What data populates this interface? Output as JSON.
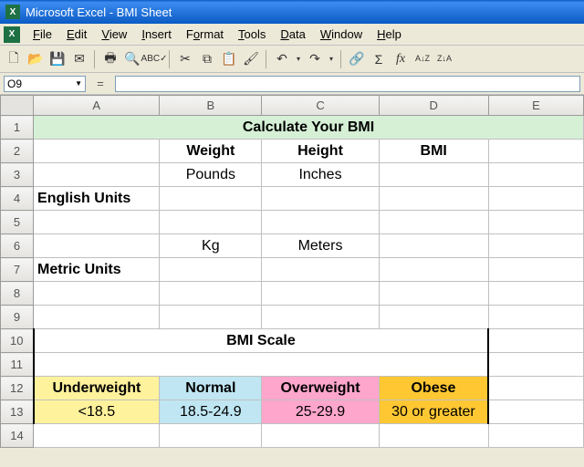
{
  "title_bar": {
    "text": "Microsoft Excel - BMI Sheet"
  },
  "menu": {
    "file": "File",
    "edit": "Edit",
    "view": "View",
    "insert": "Insert",
    "format": "Format",
    "tools": "Tools",
    "data": "Data",
    "window": "Window",
    "help": "Help"
  },
  "toolbar_icons": {
    "new": "🗋",
    "open": "📂",
    "save": "💾",
    "email": "✉",
    "print": "🖶",
    "preview": "🔍",
    "spell": "✓",
    "cut": "✂",
    "copy": "⧉",
    "paste": "📋",
    "format_painter": "🖌",
    "undo": "↶",
    "redo": "↷",
    "hyperlink": "🔗",
    "autosum": "Σ",
    "fx": "fx",
    "sort_asc": "A↓Z",
    "sort_desc": "Z↓A"
  },
  "namebox": {
    "value": "O9",
    "formula": "="
  },
  "columns": [
    "A",
    "B",
    "C",
    "D",
    "E"
  ],
  "rows": [
    "1",
    "2",
    "3",
    "4",
    "5",
    "6",
    "7",
    "8",
    "9",
    "10",
    "11",
    "12",
    "13",
    "14"
  ],
  "cells": {
    "r1_title": "Calculate Your BMI",
    "b2": "Weight",
    "c2": "Height",
    "d2": "BMI",
    "b3": "Pounds",
    "c3": "Inches",
    "a4": "English Units",
    "b6": "Kg",
    "c6": "Meters",
    "a7": "Metric Units",
    "r10_title": "BMI Scale",
    "a12": "Underweight",
    "b12": "Normal",
    "c12": "Overweight",
    "d12": "Obese",
    "a13": "<18.5",
    "b13": "18.5-24.9",
    "c13": "25-29.9",
    "d13": "30 or greater"
  }
}
